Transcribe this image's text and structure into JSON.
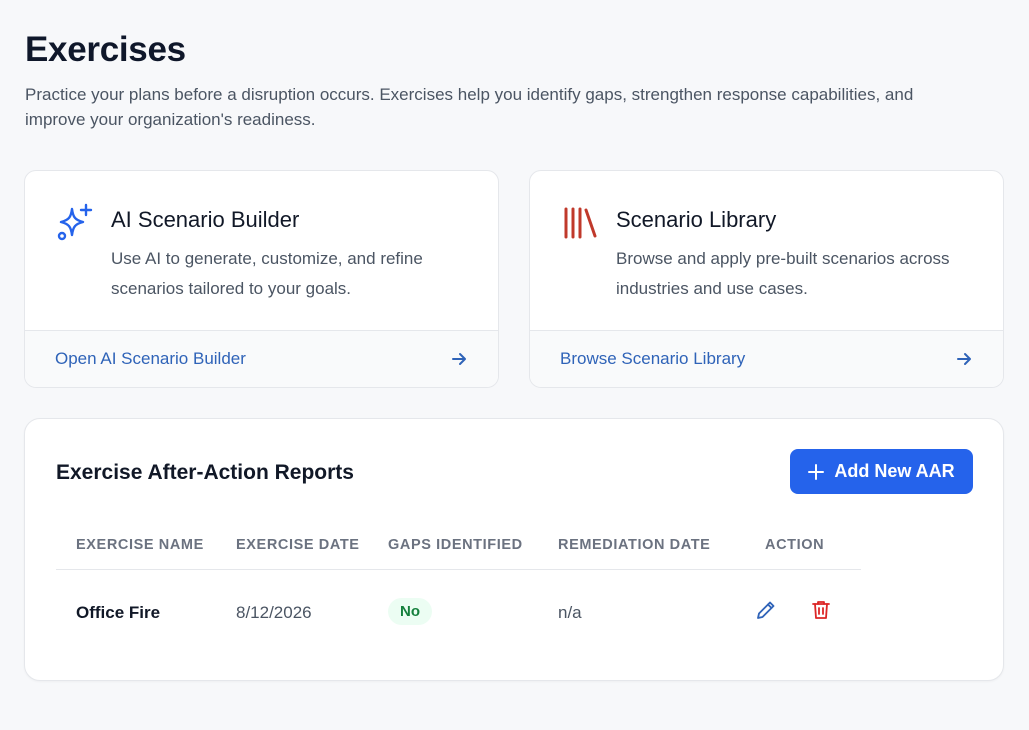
{
  "page": {
    "title": "Exercises",
    "description": "Practice your plans before a disruption occurs. Exercises help you identify gaps, strengthen response capabilities, and improve your organization's readiness."
  },
  "cards": [
    {
      "icon": "sparkles-icon",
      "title": "AI Scenario Builder",
      "text": "Use AI to generate, customize, and refine scenarios tailored to your goals.",
      "link_label": "Open AI Scenario Builder"
    },
    {
      "icon": "library-icon",
      "title": "Scenario Library",
      "text": "Browse and apply pre-built scenarios across industries and use cases.",
      "link_label": "Browse Scenario Library"
    }
  ],
  "aar": {
    "title": "Exercise After-Action Reports",
    "add_button_label": "Add New AAR",
    "columns": [
      "EXERCISE NAME",
      "EXERCISE DATE",
      "GAPS IDENTIFIED",
      "REMEDIATION DATE",
      "ACTION"
    ],
    "rows": [
      {
        "name": "Office Fire",
        "date": "8/12/2026",
        "gaps": "No",
        "remediation": "n/a",
        "actions": [
          "pencil-icon",
          "trash-icon"
        ]
      }
    ]
  },
  "colors": {
    "primary": "#2563eb",
    "link": "#2f63b8",
    "library_icon": "#c0392b",
    "delete_icon": "#dc2626",
    "badge_bg": "#ecfdf3",
    "badge_text": "#15803d"
  }
}
